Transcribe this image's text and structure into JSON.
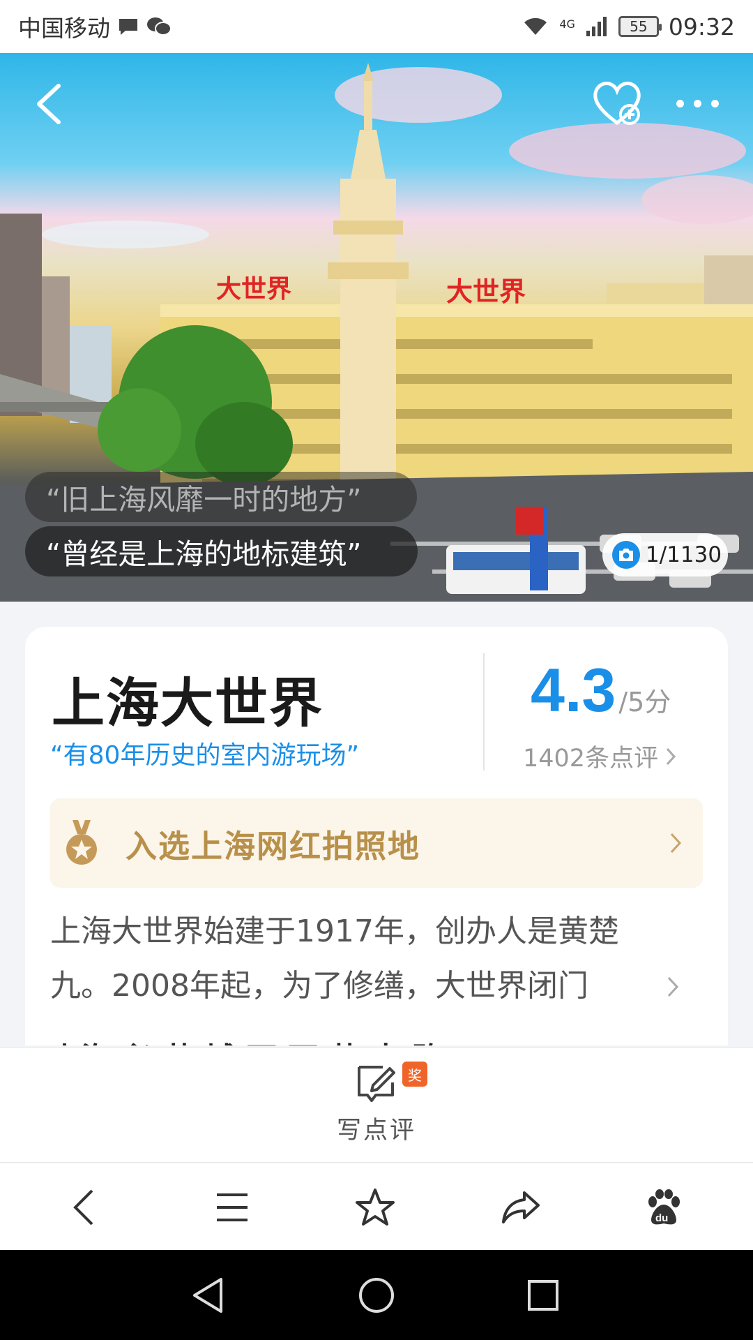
{
  "status_bar": {
    "carrier": "中国移动",
    "network": "4G",
    "battery": "55",
    "time": "09:32"
  },
  "hero": {
    "quotes": [
      "“旧上海风靡一时的地方”",
      "“曾经是上海的地标建筑”"
    ],
    "photo_counter": "1/1130",
    "sign_text": "大世界"
  },
  "attraction": {
    "name": "上海大世界",
    "tagline": "“有80年历史的室内游玩场”",
    "rating": "4.3",
    "rating_unit": "/5分",
    "review_count": "1402条点评",
    "award": "入选上海网红拍照地",
    "description": "上海大世界始建于1917年，创办人是黄楚九。2008年起，为了修缮，大世界闭门",
    "next_section_peek": "上海 必 营 城 西 西 营 去 路 口"
  },
  "review_bar": {
    "label": "写点评",
    "badge": "奖"
  },
  "toolbar": {
    "items": [
      "back-icon",
      "menu-icon",
      "star-icon",
      "share-icon",
      "baidu-icon"
    ]
  },
  "colors": {
    "accent": "#1a8fe8",
    "award_text": "#b8904a",
    "award_bg": "#fbf5ea",
    "badge": "#f0642a"
  }
}
